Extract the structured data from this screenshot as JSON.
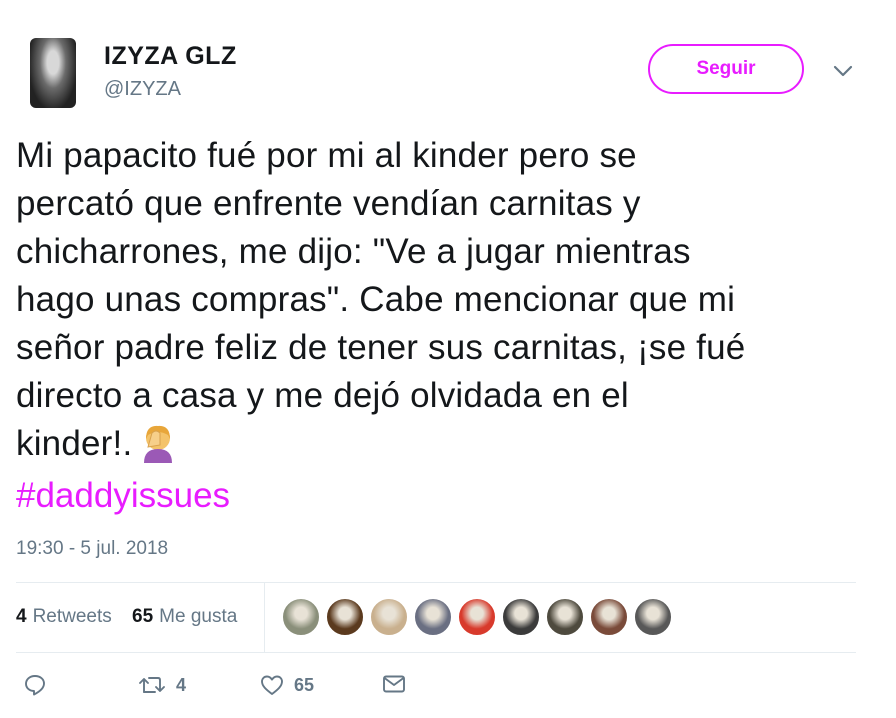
{
  "colors": {
    "accent": "#e81cff",
    "secondary_text": "#657786",
    "primary_text": "#14171a",
    "divider": "#e6ecf0"
  },
  "user": {
    "display_name": "IZYZA GLZ",
    "handle": "@IZYZA",
    "avatar_icon": "profile-photo"
  },
  "follow_button": {
    "label": "Seguir"
  },
  "tweet": {
    "lines": [
      "Mi papacito fué por mi al kinder pero se",
      "percató que enfrente vendían carnitas y",
      "chicharrones, me dijo: \"Ve a jugar mientras",
      "hago unas compras\". Cabe mencionar que mi",
      "señor padre feliz de tener sus carnitas, ¡se fué",
      "directo a casa y me dejó olvidada en el",
      "kinder!."
    ],
    "emoji": "facepalm-emoji",
    "hashtag": "#daddyissues",
    "timestamp": "19:30 - 5 jul. 2018"
  },
  "stats": {
    "retweets_count": "4",
    "retweets_label": "Retweets",
    "likes_count": "65",
    "likes_label": "Me gusta"
  },
  "likers": [
    {
      "color": "#8a8f7a"
    },
    {
      "color": "#5b3a1e"
    },
    {
      "color": "#c9b08e"
    },
    {
      "color": "#6a6f82"
    },
    {
      "color": "#d83a2c"
    },
    {
      "color": "#3b3b3b"
    },
    {
      "color": "#4e4a3e"
    },
    {
      "color": "#7a4b3a"
    },
    {
      "color": "#585858"
    }
  ],
  "actions": {
    "reply_icon": "reply-icon",
    "retweet_count": "4",
    "like_count": "65",
    "message_icon": "envelope-icon"
  }
}
